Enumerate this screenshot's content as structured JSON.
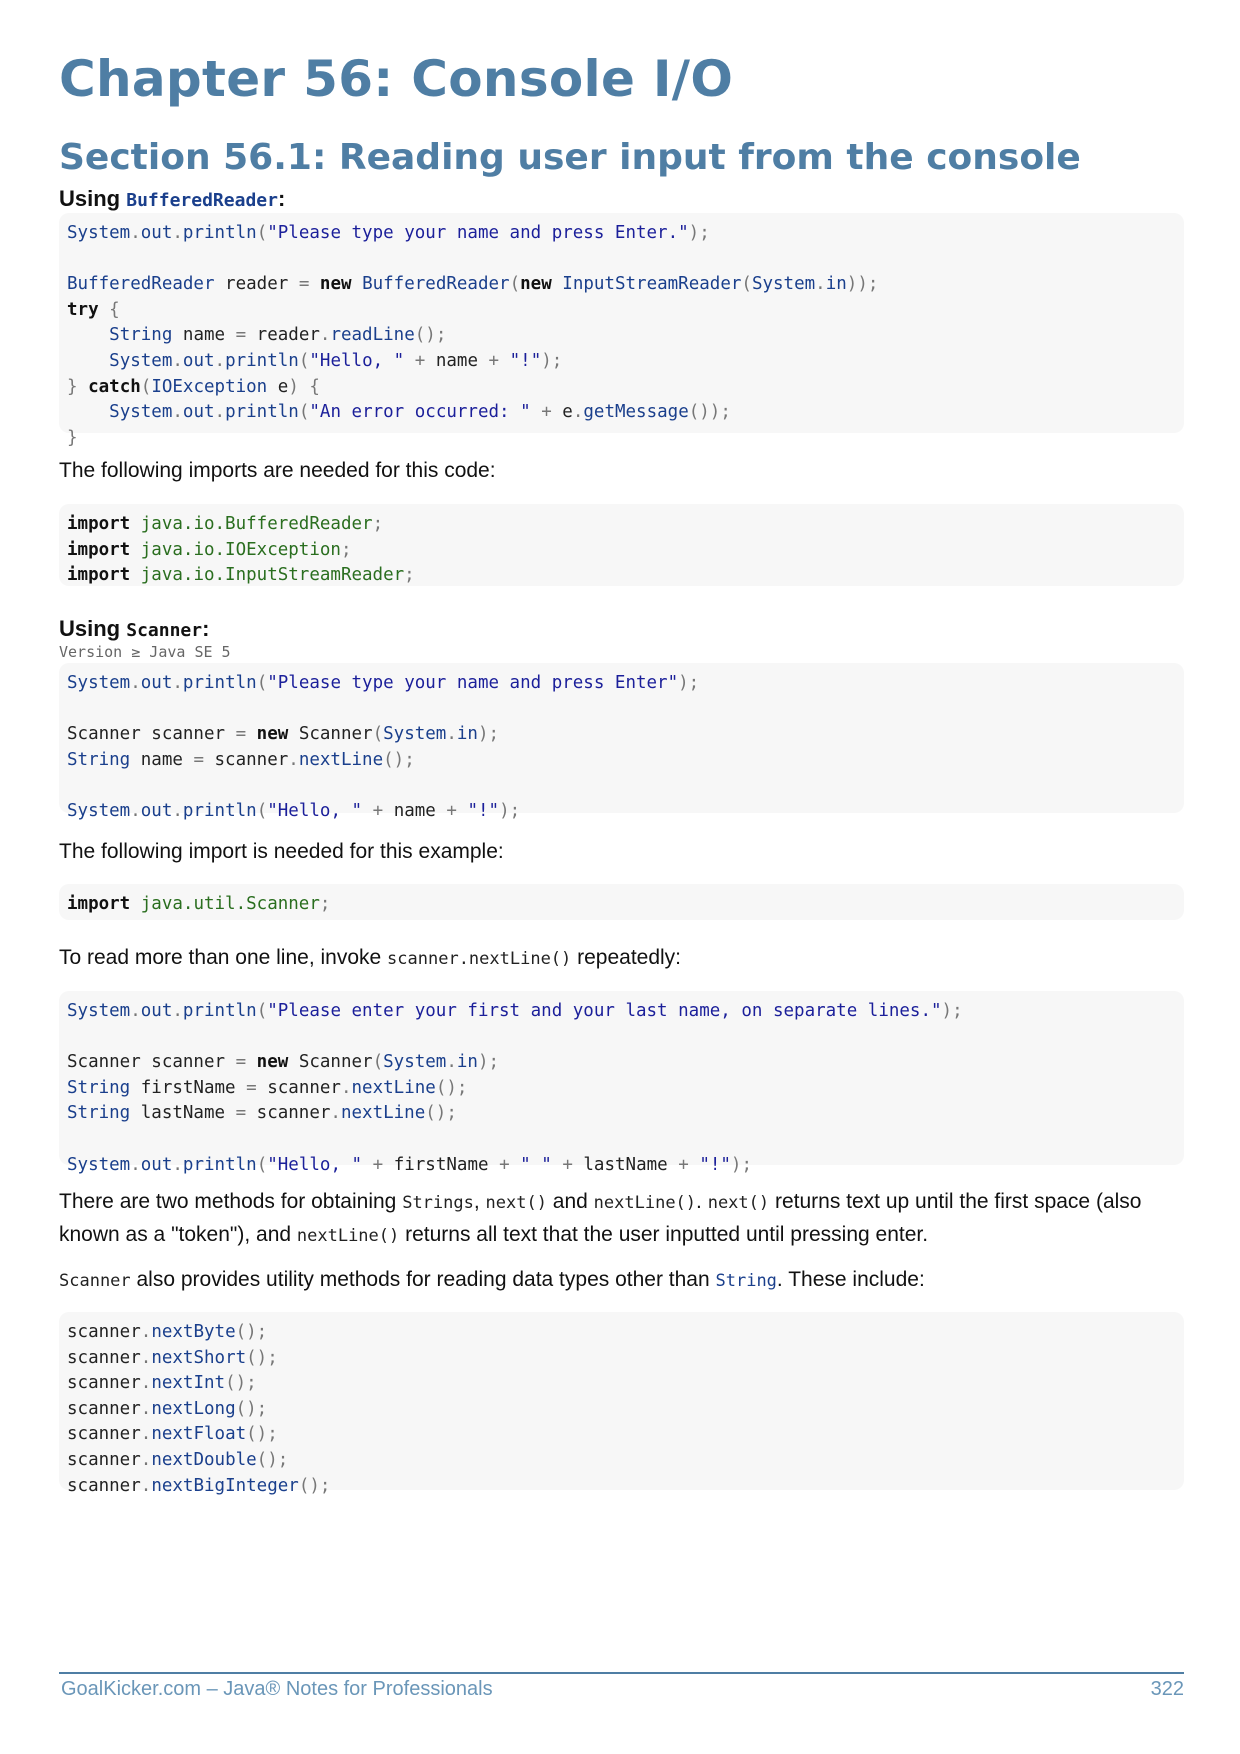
{
  "chapter_title": "Chapter 56: Console I/O",
  "section_title": "Section 56.1: Reading user input from the console",
  "sub1": {
    "prefix": "Using ",
    "code": "BufferedReader",
    "suffix": ":"
  },
  "code1": "System.out.println(\"Please type your name and press Enter.\");\n\nBufferedReader reader = new BufferedReader(new InputStreamReader(System.in));\ntry {\n    String name = reader.readLine();\n    System.out.println(\"Hello, \" + name + \"!\");\n} catch(IOException e) {\n    System.out.println(\"An error occurred: \" + e.getMessage());\n}",
  "para1": "The following imports are needed for this code:",
  "code2": "import java.io.BufferedReader;\nimport java.io.IOException;\nimport java.io.InputStreamReader;",
  "sub2": {
    "prefix": "Using ",
    "code": "Scanner",
    "suffix": ":"
  },
  "version": "Version ≥ Java SE 5",
  "code3": "System.out.println(\"Please type your name and press Enter\");\n\nScanner scanner = new Scanner(System.in);\nString name = scanner.nextLine();\n\nSystem.out.println(\"Hello, \" + name + \"!\");",
  "para2": "The following import is needed for this example:",
  "code4": "import java.util.Scanner;",
  "para3": {
    "before": "To read more than one line, invoke ",
    "code": "scanner.nextLine()",
    "after": " repeatedly:"
  },
  "code5": "System.out.println(\"Please enter your first and your last name, on separate lines.\");\n\nScanner scanner = new Scanner(System.in);\nString firstName = scanner.nextLine();\nString lastName = scanner.nextLine();\n\nSystem.out.println(\"Hello, \" + firstName + \" \" + lastName + \"!\");",
  "para4": {
    "t1": "There are two methods for obtaining ",
    "c1": "Strings",
    "t2": ", ",
    "c2": "next()",
    "t3": " and ",
    "c3": "nextLine()",
    "t4": ". ",
    "c4": "next()",
    "t5": " returns text up until the first space (also known as a \"token\"), and ",
    "c5": "nextLine()",
    "t6": " returns all text that the user inputted until pressing enter."
  },
  "para5": {
    "c1": "Scanner",
    "t1": " also provides utility methods for reading data types other than ",
    "c2": "String",
    "t2": ". These include:"
  },
  "code6": "scanner.nextByte();\nscanner.nextShort();\nscanner.nextInt();\nscanner.nextLong();\nscanner.nextFloat();\nscanner.nextDouble();\nscanner.nextBigInteger();",
  "footer": {
    "left": "GoalKicker.com – Java® Notes for Professionals",
    "page": "322"
  },
  "colors": {
    "heading": "#4f7ea4",
    "code_background": "#f7f7f7",
    "code_type": "#1a3f8c",
    "import_path": "#2a6e1f"
  }
}
